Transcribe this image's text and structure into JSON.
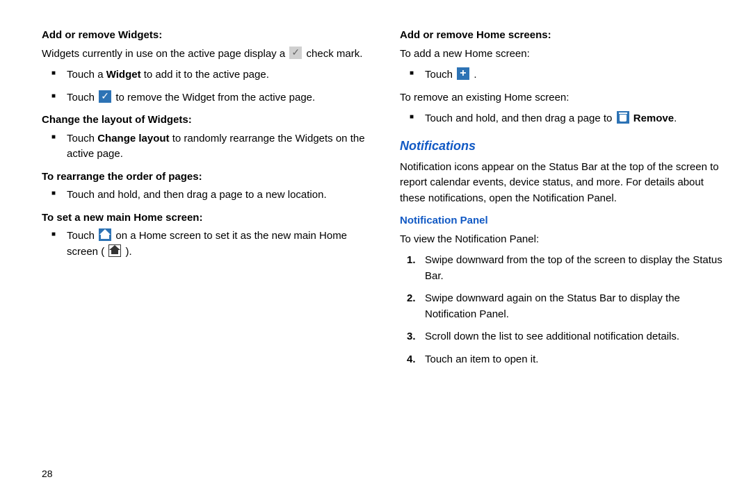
{
  "pageNumber": "28",
  "left": {
    "h1": "Add or remove Widgets:",
    "p1a": "Widgets currently in use on the active page display a ",
    "p1b": " check mark.",
    "b1a": "Touch a ",
    "b1b": "Widget",
    "b1c": " to add it to the active page.",
    "b2a": "Touch ",
    "b2b": " to remove the Widget from the active page.",
    "h2": "Change the layout of Widgets:",
    "b3a": "Touch ",
    "b3b": "Change layout",
    "b3c": " to randomly rearrange the Widgets on the active page.",
    "h3": "To rearrange the order of pages:",
    "b4": "Touch and hold, and then drag a page to a new location.",
    "h4": "To set a new main Home screen:",
    "b5a": "Touch ",
    "b5b": " on a Home screen to set it as the new main Home screen ( ",
    "b5c": " )."
  },
  "right": {
    "h1": "Add or remove Home screens:",
    "p1": "To add a new Home screen:",
    "b1a": "Touch ",
    "b1b": " .",
    "p2": "To remove an existing Home screen:",
    "b2a": "Touch and hold, and then drag a page to ",
    "b2b": "Remove",
    "b2c": ".",
    "section": "Notifications",
    "p3": "Notification icons appear on the Status Bar at the top of the screen to report calendar events, device status, and more. For details about these notifications, open the Notification Panel.",
    "sub": "Notification Panel",
    "p4": "To view the Notification Panel:",
    "n1": "Swipe downward from the top of the screen to display the Status Bar.",
    "n2": "Swipe downward again on the Status Bar to display the Notification Panel.",
    "n3": "Scroll down the list to see additional notification details.",
    "n4": "Touch an item to open it."
  }
}
